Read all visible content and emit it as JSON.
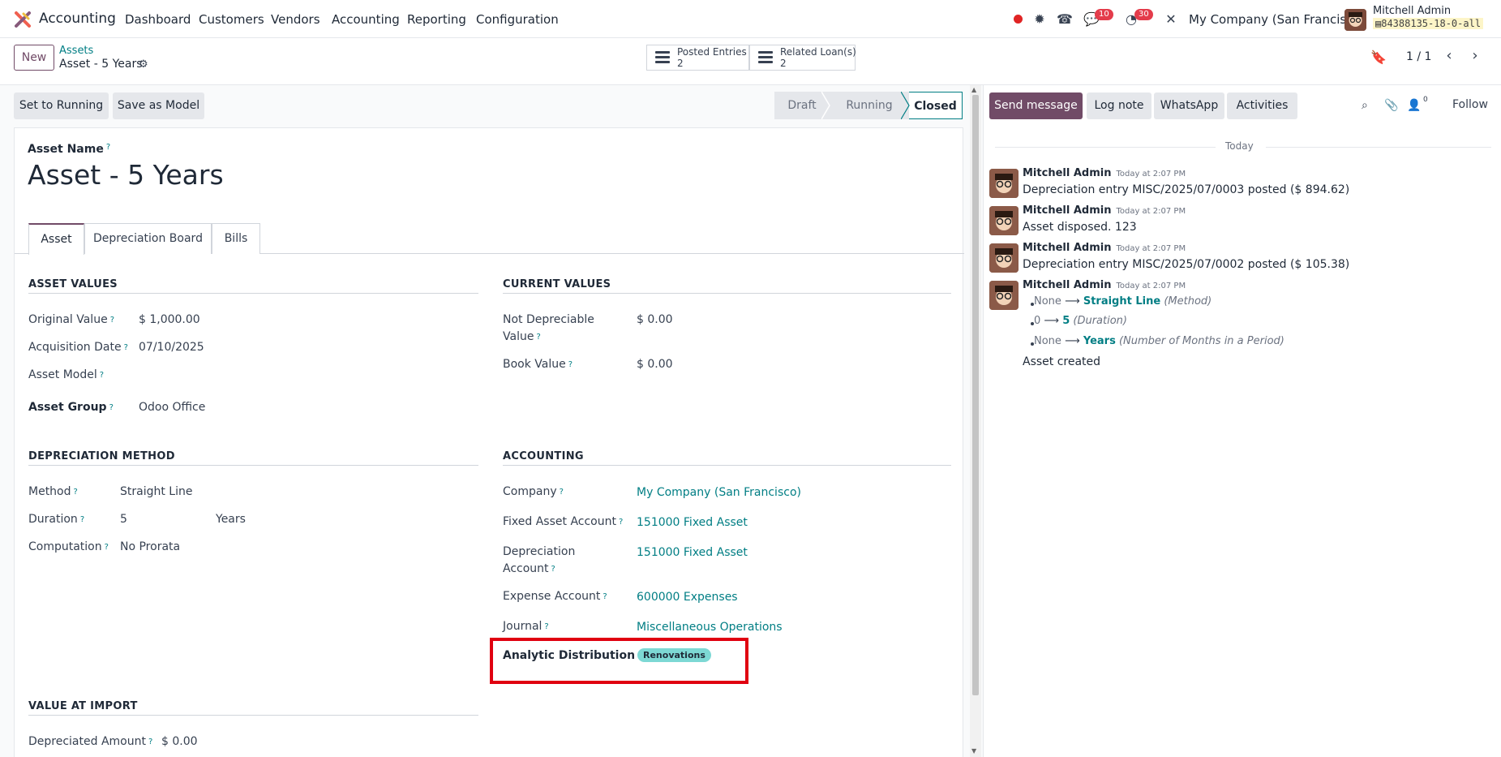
{
  "topnav": {
    "app_name": "Accounting",
    "menus": [
      "Dashboard",
      "Customers",
      "Vendors",
      "Accounting",
      "Reporting",
      "Configuration"
    ],
    "messages_badge": "10",
    "activities_badge": "30",
    "company": "My Company (San Francisco)",
    "user_name": "Mitchell Admin",
    "db_name": "84388135-18-0-all"
  },
  "control": {
    "new_label": "New",
    "breadcrumb_parent": "Assets",
    "breadcrumb_current": "Asset - 5 Years",
    "posted_entries_label": "Posted Entries",
    "posted_entries_count": "2",
    "related_loans_label": "Related Loan(s)",
    "related_loans_count": "2",
    "pager": "1 / 1"
  },
  "actions": {
    "set_running": "Set to Running",
    "save_model": "Save as Model"
  },
  "status": {
    "stages": [
      "Draft",
      "Running",
      "Closed"
    ],
    "active": "Closed"
  },
  "form": {
    "name_label": "Asset Name",
    "name": "Asset - 5 Years",
    "tabs": [
      "Asset",
      "Depreciation Board",
      "Bills"
    ],
    "asset_values": {
      "title": "ASSET VALUES",
      "original_value_label": "Original Value",
      "original_value": "$ 1,000.00",
      "acquisition_date_label": "Acquisition Date",
      "acquisition_date": "07/10/2025",
      "asset_model_label": "Asset Model",
      "asset_group_label": "Asset Group",
      "asset_group": "Odoo Office"
    },
    "current_values": {
      "title": "CURRENT VALUES",
      "not_depreciable_label_1": "Not Depreciable",
      "not_depreciable_label_2": "Value",
      "not_depreciable": "$ 0.00",
      "book_value_label": "Book Value",
      "book_value": "$ 0.00"
    },
    "depreciation_method": {
      "title": "DEPRECIATION METHOD",
      "method_label": "Method",
      "method": "Straight Line",
      "duration_label": "Duration",
      "duration": "5",
      "duration_unit": "Years",
      "computation_label": "Computation",
      "computation": "No Prorata"
    },
    "accounting": {
      "title": "ACCOUNTING",
      "company_label": "Company",
      "company": "My Company (San Francisco)",
      "fixed_asset_account_label": "Fixed Asset Account",
      "fixed_asset_account": "151000 Fixed Asset",
      "depreciation_account_label_1": "Depreciation",
      "depreciation_account_label_2": "Account",
      "depreciation_account": "151000 Fixed Asset",
      "expense_account_label": "Expense Account",
      "expense_account": "600000 Expenses",
      "journal_label": "Journal",
      "journal": "Miscellaneous Operations",
      "analytic_label": "Analytic Distribution",
      "analytic_tag": "Renovations"
    },
    "value_at_import": {
      "title": "VALUE AT IMPORT",
      "depreciated_amount_label": "Depreciated Amount",
      "depreciated_amount": "$ 0.00"
    },
    "help_mark": "?"
  },
  "chatter": {
    "send_message": "Send message",
    "log_note": "Log note",
    "whatsapp": "WhatsApp",
    "activities": "Activities",
    "followers_count": "0",
    "follow": "Follow",
    "today": "Today",
    "messages": [
      {
        "author": "Mitchell Admin",
        "time": "Today at 2:07 PM",
        "body": "Depreciation entry MISC/2025/07/0003 posted ($ 894.62)"
      },
      {
        "author": "Mitchell Admin",
        "time": "Today at 2:07 PM",
        "body": "Asset disposed. 123"
      },
      {
        "author": "Mitchell Admin",
        "time": "Today at 2:07 PM",
        "body": "Depreciation entry MISC/2025/07/0002 posted ($ 105.38)"
      },
      {
        "author": "Mitchell Admin",
        "time": "Today at 2:07 PM",
        "body": "Asset created",
        "tracking": [
          {
            "old": "None",
            "new": "Straight Line",
            "field": "(Method)"
          },
          {
            "old": "0",
            "new": "5",
            "field": "(Duration)"
          },
          {
            "old": "None",
            "new": "Years",
            "field": "(Number of Months in a Period)"
          }
        ]
      }
    ]
  },
  "colors": {
    "brand": "#714b67",
    "link": "#017e84",
    "highlight": "#e00010",
    "tag": "#7dd8d4"
  }
}
